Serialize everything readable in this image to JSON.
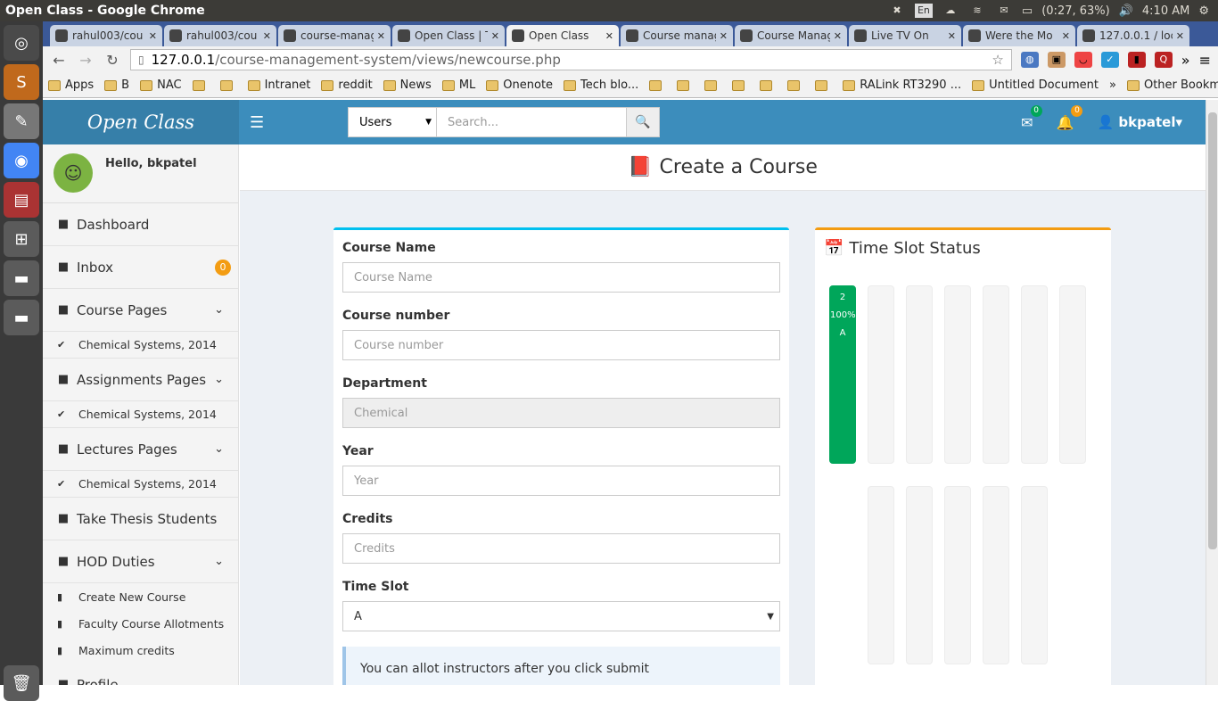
{
  "os": {
    "window_title": "Open Class - Google Chrome",
    "lang": "En",
    "battery": "(0:27, 63%)",
    "time": "4:10 AM"
  },
  "browser": {
    "tabs": [
      {
        "label": "rahul003/cou",
        "icon": "github-icon"
      },
      {
        "label": "rahul003/cou",
        "icon": "github-icon"
      },
      {
        "label": "course-manag",
        "icon": "github-icon"
      },
      {
        "label": "Open Class | T",
        "icon": "trello-icon"
      },
      {
        "label": "Open Class",
        "icon": "html5-icon",
        "active": true
      },
      {
        "label": "Course manag",
        "icon": "google-icon"
      },
      {
        "label": "Course Manag",
        "icon": "v-icon"
      },
      {
        "label": "Live TV On",
        "icon": "ibn-icon"
      },
      {
        "label": "Were the Mo",
        "icon": "reddit-icon"
      },
      {
        "label": "127.0.0.1 / loc",
        "icon": "pma-icon"
      }
    ],
    "url_host": "127.0.0.1",
    "url_path": "/course-management-system/views/newcourse.php",
    "bookmarks": [
      "Apps",
      "B",
      "NAC",
      "",
      "",
      "Intranet",
      "reddit",
      "News",
      "ML",
      "Onenote",
      "Tech blo...",
      "",
      "",
      "",
      "",
      "",
      "",
      "",
      "RALink RT3290 ...",
      "Untitled Document"
    ],
    "other_bookmarks": "Other Bookmarks",
    "more": "»"
  },
  "header": {
    "logo": "Open Class",
    "search_select": "Users",
    "search_placeholder": "Search...",
    "mail_count": "0",
    "notif_count": "0",
    "username": "bkpatel"
  },
  "sidebar": {
    "hello": "Hello, bkpatel",
    "items": [
      {
        "label": "Dashboard"
      },
      {
        "label": "Inbox",
        "badge": "0"
      },
      {
        "label": "Course Pages",
        "sub": "Chemical Systems, 2014"
      },
      {
        "label": "Assignments Pages",
        "sub": "Chemical Systems, 2014"
      },
      {
        "label": "Lectures Pages",
        "sub": "Chemical Systems, 2014"
      },
      {
        "label": "Take Thesis Students"
      },
      {
        "label": "HOD Duties",
        "subs": [
          "Create New Course",
          "Faculty Course Allotments",
          "Maximum credits"
        ]
      },
      {
        "label": "Profile"
      }
    ]
  },
  "page": {
    "title": "Create a Course"
  },
  "form": {
    "course_name_label": "Course Name",
    "course_name_ph": "Course Name",
    "course_number_label": "Course number",
    "course_number_ph": "Course number",
    "department_label": "Department",
    "department_value": "Chemical",
    "year_label": "Year",
    "year_ph": "Year",
    "credits_label": "Credits",
    "credits_ph": "Credits",
    "timeslot_label": "Time Slot",
    "timeslot_value": "A",
    "note": "You can allot instructors after you click submit"
  },
  "timeslot_status": {
    "title": "Time Slot Status",
    "filled_slot": {
      "count": "2",
      "percent": "100%",
      "slot": "A"
    }
  }
}
